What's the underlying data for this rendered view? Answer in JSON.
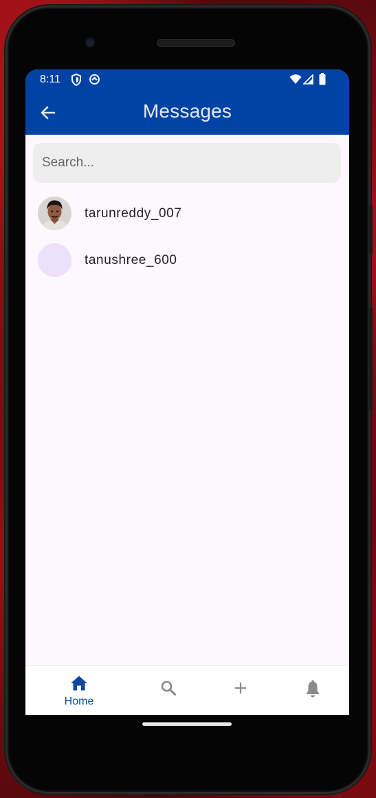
{
  "status_bar": {
    "time": "8:11",
    "left_icons": [
      "shield-icon",
      "cloud-sync-icon"
    ],
    "right_icons": [
      "wifi-icon",
      "signal-icon",
      "battery-icon"
    ]
  },
  "app_bar": {
    "title": "Messages",
    "back_icon": "arrow-back-icon",
    "color": "#0143a5"
  },
  "search": {
    "placeholder": "Search...",
    "value": ""
  },
  "users": [
    {
      "username": "tarunreddy_007",
      "avatar": "photo"
    },
    {
      "username": "tanushree_600",
      "avatar": "empty"
    }
  ],
  "bottom_nav": {
    "items": [
      {
        "icon": "home-icon",
        "label": "Home",
        "active": true
      },
      {
        "icon": "search-icon",
        "label": "",
        "active": false
      },
      {
        "icon": "add-icon",
        "label": "",
        "active": false
      },
      {
        "icon": "bell-icon",
        "label": "",
        "active": false
      }
    ],
    "active_color": "#0e47a0",
    "inactive_color": "#8a8a8a"
  }
}
